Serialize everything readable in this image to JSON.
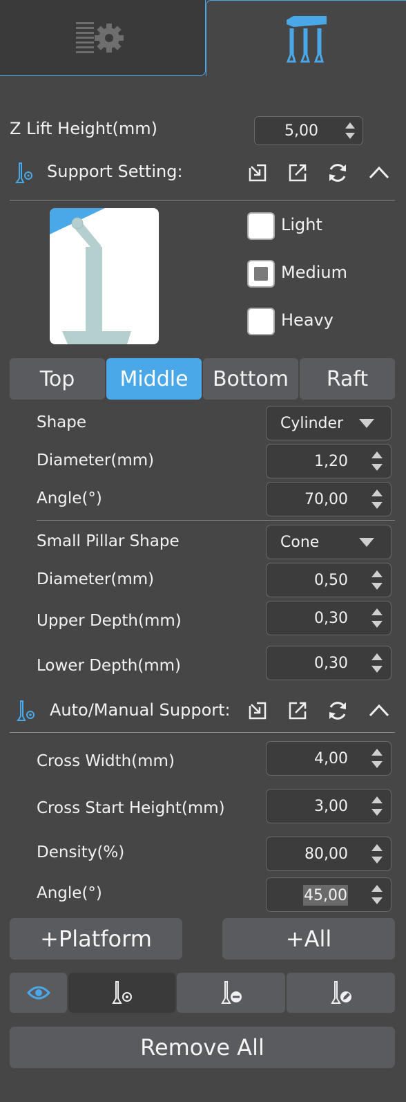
{
  "tabs": [
    {
      "name": "settings-tab",
      "icon": "settings-gear-icon"
    },
    {
      "name": "support-tab",
      "icon": "support-pillars-icon",
      "active": true
    }
  ],
  "z_lift": {
    "label": "Z Lift Height(mm)",
    "value": "5,00"
  },
  "support_setting": {
    "title": "Support Setting:",
    "icons": [
      "import-icon",
      "export-icon",
      "reset-icon",
      "collapse-icon"
    ],
    "density_options": [
      {
        "label": "Light",
        "checked": false
      },
      {
        "label": "Medium",
        "checked": true
      },
      {
        "label": "Heavy",
        "checked": false
      }
    ],
    "segments": [
      "Top",
      "Middle",
      "Bottom",
      "Raft"
    ],
    "active_segment": "Middle"
  },
  "middle": {
    "shape": {
      "label": "Shape",
      "value": "Cylinder"
    },
    "diameter": {
      "label": "Diameter(mm)",
      "value": "1,20"
    },
    "angle": {
      "label": "Angle(°)",
      "value": "70,00"
    },
    "small_pillar_shape": {
      "label": "Small Pillar Shape",
      "value": "Cone"
    },
    "small_diameter": {
      "label": "Diameter(mm)",
      "value": "0,50"
    },
    "upper_depth": {
      "label": "Upper Depth(mm)",
      "value": "0,30"
    },
    "lower_depth": {
      "label": "Lower Depth(mm)",
      "value": "0,30"
    }
  },
  "auto_manual": {
    "title": "Auto/Manual Support:",
    "cross_width": {
      "label": "Cross Width(mm)",
      "value": "4,00"
    },
    "cross_start_height": {
      "label": "Cross Start Height(mm)",
      "value": "3,00"
    },
    "density": {
      "label": "Density(%)",
      "value": "80,00"
    },
    "angle": {
      "label": "Angle(°)",
      "value": "45,00"
    }
  },
  "buttons": {
    "platform": "+Platform",
    "all": "+All",
    "remove_all": "Remove All"
  },
  "tools": [
    "eye-icon",
    "add-support-icon",
    "remove-support-icon",
    "edit-support-icon"
  ],
  "colors": {
    "accent": "#4aa8e8",
    "background": "#464646",
    "button": "#5a5b5e"
  }
}
